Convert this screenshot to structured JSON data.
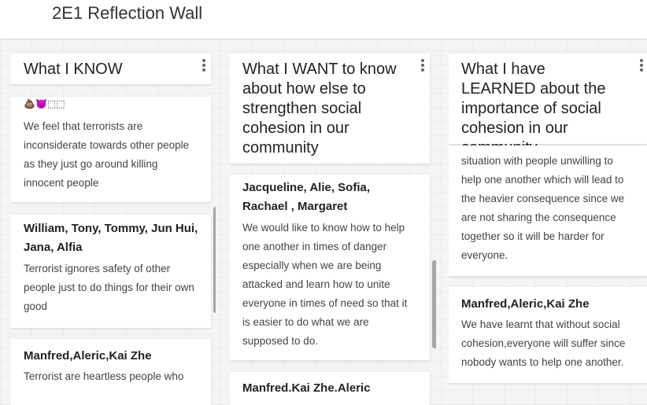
{
  "app": {
    "title": "2E1 Reflection Wall"
  },
  "columns": [
    {
      "title": "What I KNOW",
      "cards": [
        {
          "emoji": "💩😈⬚⬚",
          "author": "",
          "body": "We feel that terrorists are inconsiderate towards other people as they just go around killing innocent people"
        },
        {
          "author": "William, Tony, Tommy, Jun Hui, Jana, Alfia",
          "body": "Terrorist ignores safety of other people just to do things for their own good"
        },
        {
          "author": "Manfred,Aleric,Kai Zhe",
          "body": "Terrorist are heartless people who"
        }
      ]
    },
    {
      "title": "What I WANT to know about how else to strengthen social cohesion in our community",
      "cards": [
        {
          "author": "Jacqueline, Alie, Sofia, Rachael , Margaret",
          "body": "We would like to know how to help one another in times of danger especially when we are being attacked and learn how to unite everyone in times of need so that it is easier to do what we are supposed to do."
        },
        {
          "author": "Manfred.Kai Zhe.Aleric",
          "body": ""
        }
      ]
    },
    {
      "title": "What I have LEARNED about the importance of social cohesion in our community",
      "cards": [
        {
          "author": "",
          "body": "situation with people unwilling to help one another which will lead to the heavier consequence since we are not sharing the consequence together so it will be harder for everyone."
        },
        {
          "author": "Manfred,Aleric,Kai Zhe",
          "body": "We have learnt that without social cohesion,everyone will suffer since nobody wants to help one another."
        }
      ]
    }
  ]
}
